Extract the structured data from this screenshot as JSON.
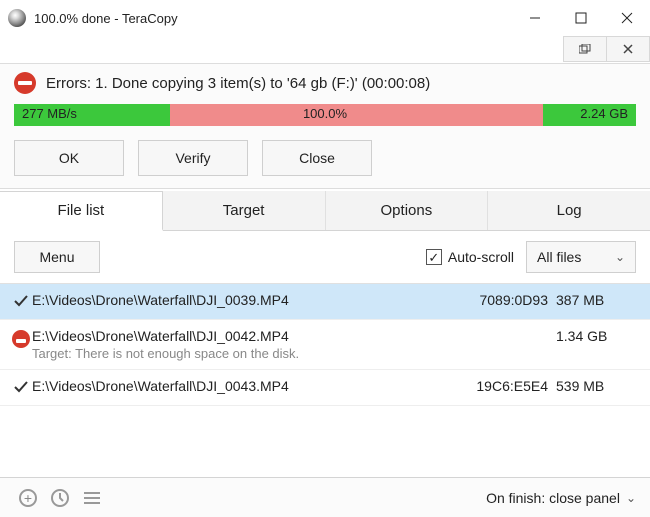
{
  "titlebar": {
    "title": "100.0% done - TeraCopy"
  },
  "status": {
    "message": "Errors: 1. Done copying 3 item(s) to '64 gb (F:)' (00:00:08)"
  },
  "progress": {
    "speed": "277 MB/s",
    "percent": "100.0%",
    "total": "2.24 GB",
    "green_left_pct": 25,
    "red_pct": 60,
    "green_right_pct": 15
  },
  "buttons": {
    "ok": "OK",
    "verify": "Verify",
    "close": "Close"
  },
  "tabs": {
    "file_list": "File list",
    "target": "Target",
    "options": "Options",
    "log": "Log"
  },
  "file_toolbar": {
    "menu": "Menu",
    "auto_scroll": "Auto-scroll",
    "filter": "All files"
  },
  "files": [
    {
      "path": "E:\\Videos\\Drone\\Waterfall\\DJI_0039.MP4",
      "hash": "7089:0D93",
      "size": "387 MB",
      "status": "ok",
      "selected": true
    },
    {
      "path": "E:\\Videos\\Drone\\Waterfall\\DJI_0042.MP4",
      "hash": "",
      "size": "1.34 GB",
      "status": "error",
      "error": "Target: There is not enough space on the disk.",
      "selected": false
    },
    {
      "path": "E:\\Videos\\Drone\\Waterfall\\DJI_0043.MP4",
      "hash": "19C6:E5E4",
      "size": "539 MB",
      "status": "ok",
      "selected": false
    }
  ],
  "bottom": {
    "on_finish": "On finish: close panel"
  }
}
